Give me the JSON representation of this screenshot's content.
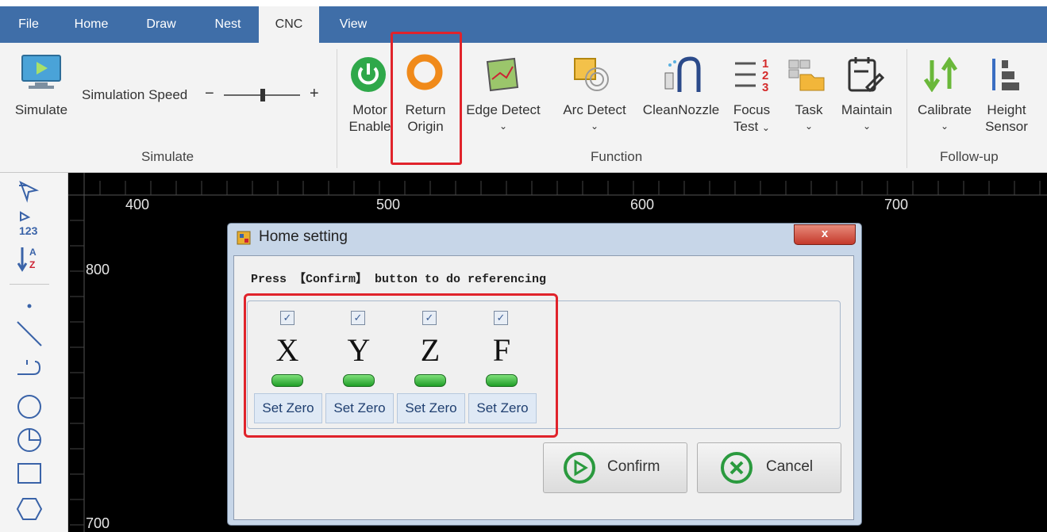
{
  "tabs": [
    "File",
    "Home",
    "Draw",
    "Nest",
    "CNC",
    "View"
  ],
  "active_tab": "CNC",
  "simulate": {
    "button_label": "Simulate",
    "speed_label": "Simulation Speed",
    "minus": "−",
    "plus": "+",
    "group_label": "Simulate"
  },
  "function": {
    "motor_line1": "Motor",
    "motor_line2": "Enable",
    "return_line1": "Return",
    "return_line2": "Origin",
    "edge_detect": "Edge Detect",
    "arc_detect": "Arc Detect",
    "clean_nozzle": "CleanNozzle",
    "focus_line1": "Focus",
    "focus_line2": "Test",
    "task": "Task",
    "maintain": "Maintain",
    "group_label": "Function",
    "focus_icon_nums": [
      "1",
      "2",
      "3"
    ]
  },
  "followup": {
    "calibrate": "Calibrate",
    "height_line1": "Height",
    "height_line2": "Sensor",
    "group_label": "Follow-up"
  },
  "canvas": {
    "top_ruler": [
      "400",
      "500",
      "600",
      "700"
    ],
    "left_ruler": [
      "800",
      "700"
    ]
  },
  "lefttools": {
    "numbers_label": "123",
    "sort_a": "A",
    "sort_z": "Z"
  },
  "dialog": {
    "title": "Home setting",
    "close": "x",
    "instruction": "Press 【Confirm】 button to do referencing",
    "axes": [
      {
        "letter": "X",
        "checked": true,
        "set_zero": "Set Zero"
      },
      {
        "letter": "Y",
        "checked": true,
        "set_zero": "Set Zero"
      },
      {
        "letter": "Z",
        "checked": true,
        "set_zero": "Set Zero"
      },
      {
        "letter": "F",
        "checked": true,
        "set_zero": "Set Zero"
      }
    ],
    "confirm": "Confirm",
    "cancel": "Cancel"
  },
  "colors": {
    "tabbar": "#3f6ea8",
    "highlight": "#e0232b",
    "canvas": "#000000",
    "led": "#2fbf3a"
  }
}
